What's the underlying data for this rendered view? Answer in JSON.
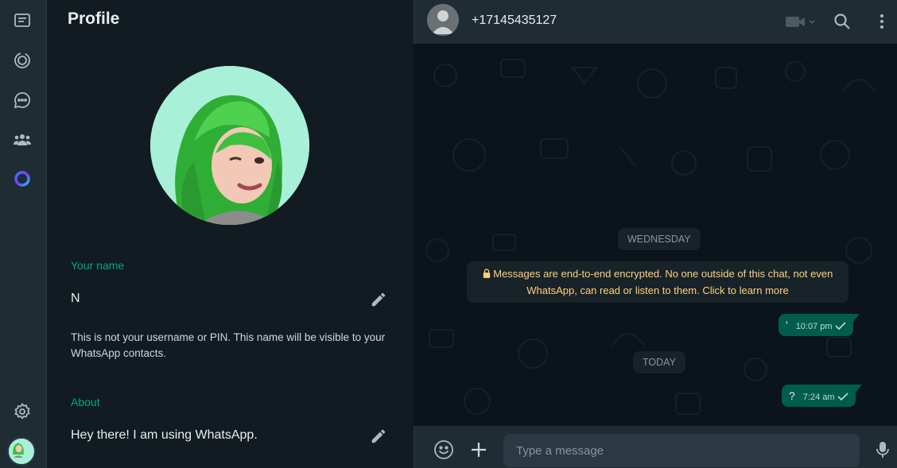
{
  "profile": {
    "title": "Profile",
    "name_label": "Your name",
    "name_value": "N",
    "name_hint": "This is not your username or PIN. This name will be visible to your WhatsApp contacts.",
    "about_label": "About",
    "about_value": "Hey there! I am using WhatsApp."
  },
  "chat": {
    "contact": "+17145435127",
    "day_1": "WEDNESDAY",
    "encryption_notice": "Messages are end-to-end encrypted. No one outside of this chat, not even WhatsApp, can read or listen to them. Click to learn more",
    "day_2": "TODAY",
    "messages": [
      {
        "text": "'",
        "time": "10:07 pm"
      },
      {
        "text": "?",
        "time": "7:24 am"
      }
    ]
  },
  "compose": {
    "placeholder": "Type a message"
  },
  "colors": {
    "accent": "#00a884",
    "outgoing_bubble": "#005c4b",
    "panel": "#202c33",
    "background": "#111b21"
  },
  "icons": [
    "chats-icon",
    "status-icon",
    "channels-icon",
    "communities-icon",
    "meta-ai-icon",
    "settings-icon",
    "avatar",
    "video-call-icon",
    "search-icon",
    "menu-icon",
    "emoji-icon",
    "attach-icon",
    "mic-icon",
    "pencil-icon",
    "lock-icon",
    "check-icon"
  ]
}
